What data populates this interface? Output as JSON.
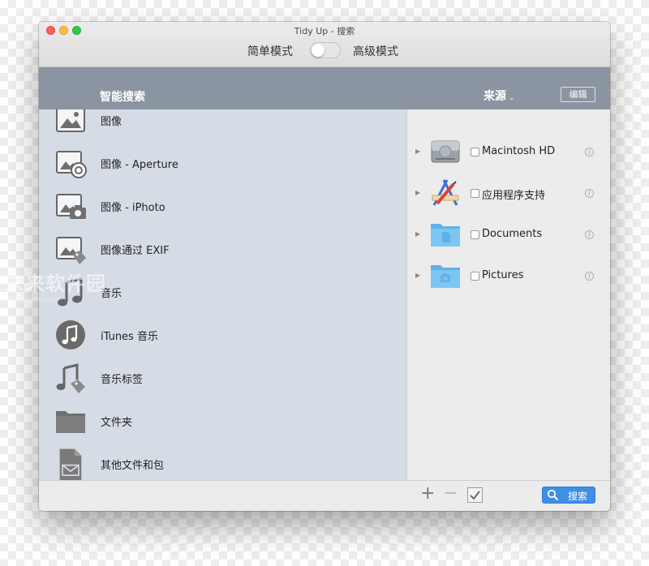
{
  "window": {
    "title": "Tidy Up - 搜索"
  },
  "mode": {
    "simple_label": "简单模式",
    "advanced_label": "高级模式",
    "toggle_on": false
  },
  "header": {
    "smart_search": "智能搜索",
    "source": "来源",
    "edit": "编辑"
  },
  "categories": [
    {
      "label": "图像",
      "icon": "image-icon"
    },
    {
      "label": "图像 - Aperture",
      "icon": "aperture-image-icon"
    },
    {
      "label": "图像 - iPhoto",
      "icon": "iphoto-image-icon"
    },
    {
      "label": "图像通过 EXIF",
      "icon": "exif-image-icon"
    },
    {
      "label": "音乐",
      "icon": "music-note-icon"
    },
    {
      "label": "iTunes 音乐",
      "icon": "itunes-icon"
    },
    {
      "label": "音乐标签",
      "icon": "music-tag-icon"
    },
    {
      "label": "文件夹",
      "icon": "folder-icon"
    },
    {
      "label": "其他文件和包",
      "icon": "document-icon"
    }
  ],
  "sources": [
    {
      "label": "Macintosh HD",
      "icon": "hard-drive-icon",
      "checked": false
    },
    {
      "label": "应用程序支持",
      "icon": "applications-icon",
      "checked": false
    },
    {
      "label": "Documents",
      "icon": "documents-folder-icon",
      "checked": false
    },
    {
      "label": "Pictures",
      "icon": "pictures-folder-icon",
      "checked": false
    }
  ],
  "bottom": {
    "add": "+",
    "remove": "−",
    "search_label": "搜索"
  },
  "watermark": {
    "text": "未来软件园",
    "sub": "mac.orsoon.com"
  },
  "colors": {
    "header": "#8b95a1",
    "left_panel": "#d6dce5",
    "accent": "#3f8fe6"
  }
}
